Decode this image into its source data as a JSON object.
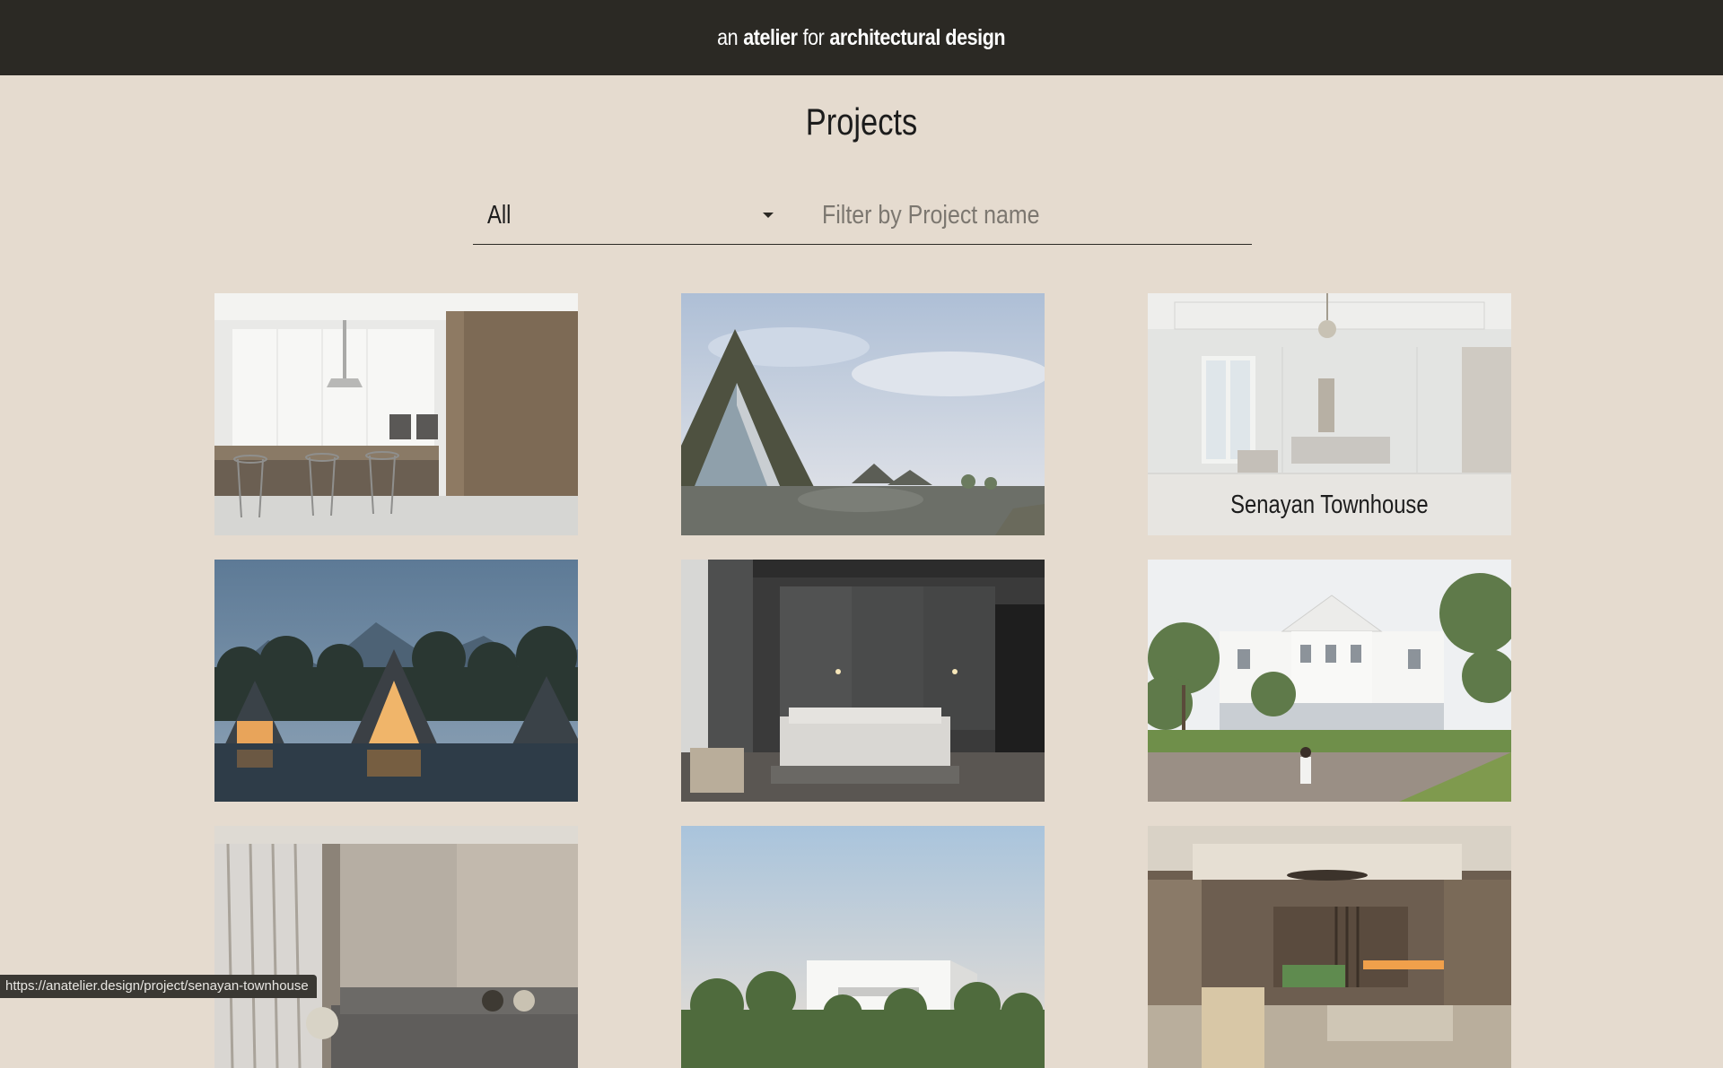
{
  "header": {
    "brand_parts": [
      "an",
      "atelier",
      "for",
      "architectural design"
    ]
  },
  "main": {
    "title": "Projects",
    "filter": {
      "category_value": "All",
      "search_placeholder": "Filter by Project name"
    },
    "projects": [
      {
        "image": "modern-kitchen-interior"
      },
      {
        "image": "a-frame-cabin-landscape"
      },
      {
        "image": "classic-living-room",
        "name": "Senayan Townhouse",
        "hovered": true
      },
      {
        "image": "a-frame-cabins-lake-night"
      },
      {
        "image": "dark-bedroom-interior"
      },
      {
        "image": "white-colonial-house"
      },
      {
        "image": "living-room-sofa"
      },
      {
        "image": "white-modern-villa"
      },
      {
        "image": "warm-living-room-ceiling-fan"
      }
    ]
  },
  "status_bar": {
    "url": "https://anatelier.design/project/senayan-townhouse"
  },
  "colors": {
    "header_bg": "#2b2924",
    "page_bg": "#e5dbcf"
  }
}
